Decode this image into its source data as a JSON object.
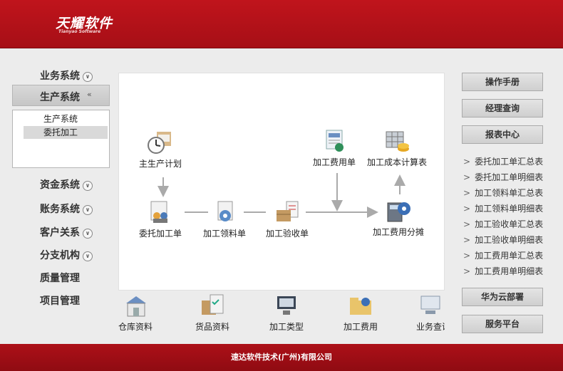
{
  "header": {
    "logo_main": "天耀软件",
    "logo_sub": "Tianyao Software"
  },
  "nav": {
    "items": [
      {
        "label": "业务系统",
        "chevron": true
      },
      {
        "label": "生产系统",
        "chevron": true,
        "active": true
      },
      {
        "label": "资金系统",
        "chevron": true
      },
      {
        "label": "账务系统",
        "chevron": true
      },
      {
        "label": "客户关系",
        "chevron": true
      },
      {
        "label": "分支机构",
        "chevron": true
      },
      {
        "label": "质量管理",
        "chevron": false
      },
      {
        "label": "项目管理",
        "chevron": false
      }
    ],
    "sub_items": [
      {
        "label": "生产系统",
        "selected": false
      },
      {
        "label": "委托加工",
        "selected": true
      }
    ]
  },
  "flow": {
    "nodes": {
      "master_plan": "主生产计划",
      "outsource_order": "委托加工单",
      "material_pick": "加工领料单",
      "inspection": "加工验收单",
      "cost_sheet": "加工费用单",
      "cost_calc": "加工成本计算表",
      "cost_allocation": "加工费用分摊"
    }
  },
  "bottom": {
    "items": [
      "仓库资料",
      "货品资料",
      "加工类型",
      "加工费用",
      "业务查询"
    ]
  },
  "right": {
    "buttons_top": [
      "操作手册",
      "经理查询",
      "报表中心"
    ],
    "links": [
      "委托加工单汇总表",
      "委托加工单明细表",
      "加工领料单汇总表",
      "加工领料单明细表",
      "加工验收单汇总表",
      "加工验收单明细表",
      "加工费用单汇总表",
      "加工费用单明细表"
    ],
    "buttons_bottom": [
      "华为云部署",
      "服务平台"
    ]
  },
  "footer": {
    "text": "速达软件技术(广州)有限公司"
  },
  "colors": {
    "brand_red": "#b0121a",
    "panel_gray": "#ececec",
    "arrow": "#aaaaaa"
  }
}
